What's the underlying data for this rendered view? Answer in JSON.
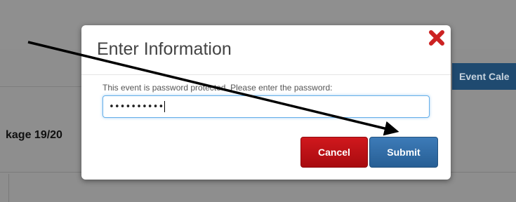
{
  "background": {
    "tab_label": "Event Cale",
    "package_label": "kage 19/20"
  },
  "modal": {
    "title": "Enter Information",
    "close_icon": "close-x-icon",
    "prompt": "This event is password protected. Please enter the password:",
    "password_value": "••••••••••",
    "cancel_label": "Cancel",
    "submit_label": "Submit"
  },
  "colors": {
    "close": "#cc2222",
    "cancel": "#c0161a",
    "submit": "#2f6aa6",
    "arrow": "#000000"
  }
}
